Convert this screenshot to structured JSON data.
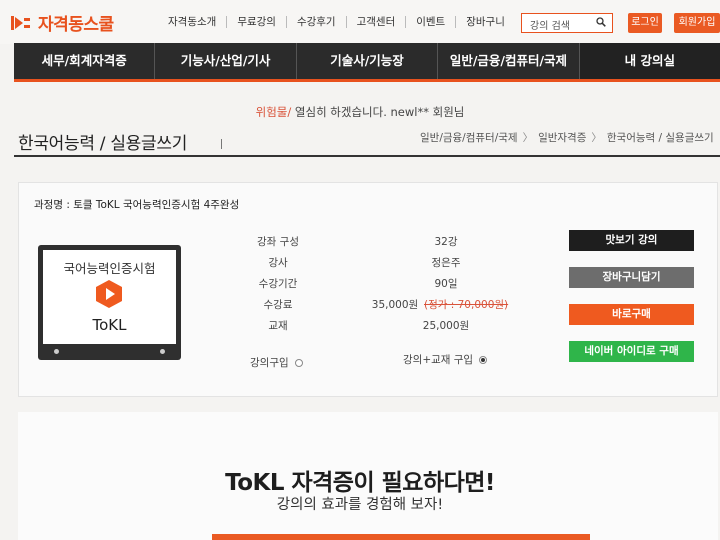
{
  "brand": {
    "name": "자격동스쿨",
    "accent": "#e8521e"
  },
  "top_nav": [
    "자격동소개",
    "무료강의",
    "수강후기",
    "고객센터",
    "이벤트",
    "장바구니"
  ],
  "search": {
    "placeholder": "강의 검색"
  },
  "auth": {
    "login": "로그인",
    "join": "회원가입"
  },
  "category_nav": [
    "세무/회계자격증",
    "기능사/산업/기사",
    "기술사/기능장",
    "일반/금융/컴퓨터/국제",
    "내 강의실"
  ],
  "welcome": {
    "user_id": "위험물",
    "slash": "/",
    "message": "열심히 하겠습니다. newl** 회원님"
  },
  "page": {
    "title": "한국어능력 / 실용글쓰기",
    "breadcrumb": [
      "일반/금융/컴퓨터/국제",
      "일반자격증",
      "한국어능력 / 실용글쓰기"
    ]
  },
  "product": {
    "course_label": "과정명 : 토클 ToKL 국어능력인증시험 4주완성",
    "thumbnail": {
      "top_text": "국어능력인증시험",
      "bottom_text": "ToKL"
    },
    "info": [
      {
        "label": "강좌 구성",
        "value": "32강"
      },
      {
        "label": "강사",
        "value": "정은주"
      },
      {
        "label": "수강기간",
        "value": "90일"
      },
      {
        "label": "수강료",
        "value": "35,000원",
        "original": "(정가 : 70,000원)"
      },
      {
        "label": "교재",
        "value": "25,000원"
      }
    ],
    "purchase_options": [
      {
        "label": "강의구입",
        "selected": false
      },
      {
        "label": "강의+교재 구입",
        "selected": true
      }
    ],
    "buttons": {
      "preview": "맛보기 강의",
      "cart": "장바구니담기",
      "buy": "바로구매",
      "naver": "네이버 아이디로 구매"
    }
  },
  "promo": {
    "title": "ToKL 자격증이 필요하다면!",
    "subtitle": "강의의 효과를 경험해 보자!"
  }
}
